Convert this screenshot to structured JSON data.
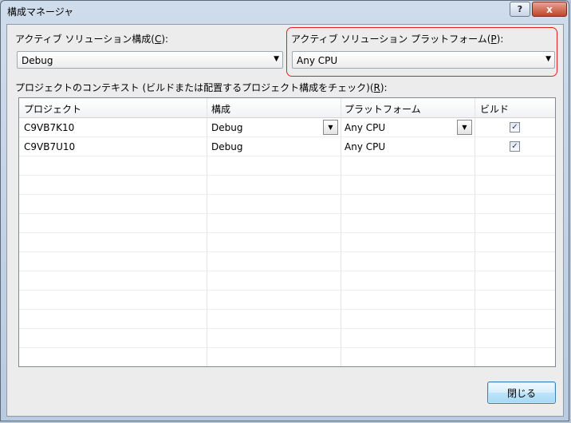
{
  "window": {
    "title": "構成マネージャ",
    "help_label": "?",
    "close_label": "x"
  },
  "solution_config": {
    "label_prefix": "アクティブ ソリューション構成(",
    "label_key": "C",
    "label_suffix": "):",
    "value": "Debug"
  },
  "solution_platform": {
    "label_prefix": "アクティブ ソリューション プラットフォーム(",
    "label_key": "P",
    "label_suffix": "):",
    "value": "Any CPU"
  },
  "context": {
    "label_prefix": "プロジェクトのコンテキスト (ビルドまたは配置するプロジェクト構成をチェック)(",
    "label_key": "R",
    "label_suffix": "):"
  },
  "grid": {
    "headers": [
      "プロジェクト",
      "構成",
      "プラットフォーム",
      "ビルド"
    ],
    "rows": [
      {
        "project": "C9VB7K10",
        "config": "Debug",
        "platform": "Any CPU",
        "build": true
      },
      {
        "project": "C9VB7U10",
        "config": "Debug",
        "platform": "Any CPU",
        "build": true
      }
    ]
  },
  "close_button": "閉じる",
  "icons": {
    "dropdown": "chevron-down-icon",
    "check": "checkmark-icon"
  }
}
